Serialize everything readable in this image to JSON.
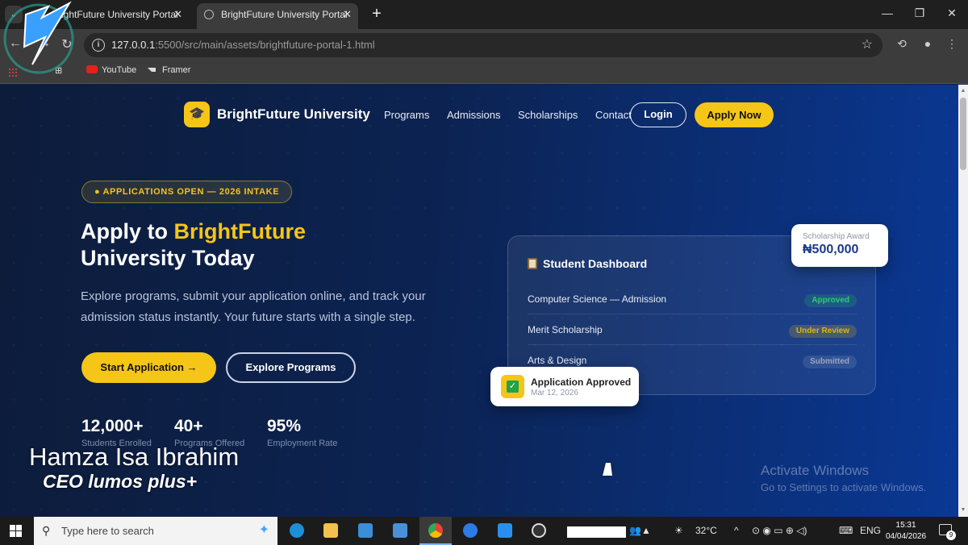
{
  "browser": {
    "tabs": [
      {
        "title": "BrightFuture University Portal"
      },
      {
        "title": "BrightFuture University Portal"
      }
    ],
    "url_host": "127.0.0.1",
    "url_path": ":5500/src/main/assets/brightfuture-portal-1.html",
    "bookmarks": [
      {
        "label": "YouTube",
        "icon": "youtube-icon"
      },
      {
        "label": "Framer",
        "icon": "framer-icon"
      }
    ]
  },
  "site": {
    "brand": "BrightFuture University",
    "logo_icon": "🎓",
    "nav": [
      "Programs",
      "Admissions",
      "Scholarships",
      "Contact"
    ],
    "login_label": "Login",
    "apply_label": "Apply Now"
  },
  "hero": {
    "badge": "● APPLICATIONS OPEN — 2026 INTAKE",
    "title_prefix": "Apply to ",
    "title_highlight": "BrightFuture",
    "title_line2": "University Today",
    "description": "Explore programs, submit your application online, and track your admission status instantly. Your future starts with a single step.",
    "start_label": "Start Application →",
    "explore_label": "Explore Programs",
    "stats": [
      {
        "value": "12,000+",
        "label": "Students Enrolled"
      },
      {
        "value": "40+",
        "label": "Programs Offered"
      },
      {
        "value": "95%",
        "label": "Employment Rate"
      }
    ]
  },
  "dashboard": {
    "title": "Student Dashboard",
    "rows": [
      {
        "label": "Computer Science — Admission",
        "status": "Approved"
      },
      {
        "label": "Merit Scholarship",
        "status": "Under Review"
      },
      {
        "label": "Arts & Design",
        "status": "Submitted"
      }
    ]
  },
  "scholarship_card": {
    "label": "Scholarship Award",
    "value": "₦500,000"
  },
  "approved_card": {
    "title": "Application Approved",
    "date": "Mar 12, 2026"
  },
  "activate": {
    "title": "Activate Windows",
    "subtitle": "Go to Settings to activate Windows."
  },
  "watermark": {
    "name": "Hamza Isa Ibrahim",
    "role": "CEO lumos plus+"
  },
  "taskbar": {
    "search_placeholder": "Type here to search",
    "weather": "32°C",
    "language": "ENG",
    "time": "15:31",
    "date": "04/04/2026",
    "notification_count": "9"
  },
  "colors": {
    "accent": "#f5c518",
    "approved": "#2ecc71",
    "page_bg": "#0c2352"
  }
}
